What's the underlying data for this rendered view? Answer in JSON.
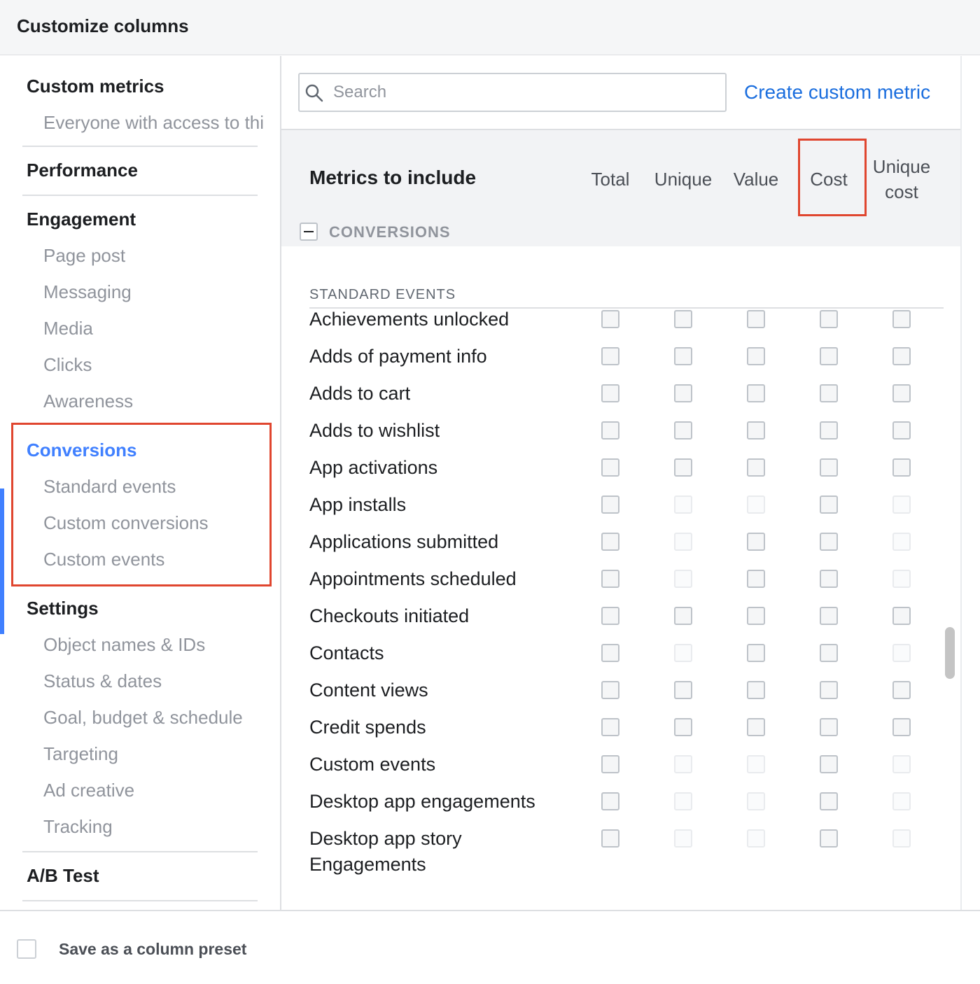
{
  "dialog": {
    "title": "Customize columns"
  },
  "sidebar": {
    "sections": [
      {
        "title": "Custom metrics",
        "items": [
          "Everyone with access to thi"
        ]
      },
      {
        "title": "Performance",
        "items": []
      },
      {
        "title": "Engagement",
        "items": [
          "Page post",
          "Messaging",
          "Media",
          "Clicks",
          "Awareness"
        ]
      },
      {
        "title": "Conversions",
        "active": true,
        "items": [
          "Standard events",
          "Custom conversions",
          "Custom events"
        ]
      },
      {
        "title": "Settings",
        "items": [
          "Object names & IDs",
          "Status & dates",
          "Goal, budget & schedule",
          "Targeting",
          "Ad creative",
          "Tracking"
        ]
      },
      {
        "title": "A/B Test",
        "items": []
      }
    ]
  },
  "search": {
    "placeholder": "Search",
    "value": ""
  },
  "create_link": "Create custom metric",
  "metrics": {
    "title": "Metrics to include",
    "columns": [
      "Total",
      "Unique",
      "Value",
      "Cost",
      "Unique\ncost"
    ],
    "group_label": "CONVERSIONS",
    "subgroup_label": "STANDARD EVENTS",
    "rows": [
      {
        "label": "Achievements unlocked",
        "enabled": [
          true,
          true,
          true,
          true,
          true
        ]
      },
      {
        "label": "Adds of payment info",
        "enabled": [
          true,
          true,
          true,
          true,
          true
        ]
      },
      {
        "label": "Adds to cart",
        "enabled": [
          true,
          true,
          true,
          true,
          true
        ]
      },
      {
        "label": "Adds to wishlist",
        "enabled": [
          true,
          true,
          true,
          true,
          true
        ]
      },
      {
        "label": "App activations",
        "enabled": [
          true,
          true,
          true,
          true,
          true
        ]
      },
      {
        "label": "App installs",
        "enabled": [
          true,
          false,
          false,
          true,
          false
        ]
      },
      {
        "label": "Applications submitted",
        "enabled": [
          true,
          false,
          true,
          true,
          false
        ]
      },
      {
        "label": "Appointments scheduled",
        "enabled": [
          true,
          false,
          true,
          true,
          false
        ]
      },
      {
        "label": "Checkouts initiated",
        "enabled": [
          true,
          true,
          true,
          true,
          true
        ]
      },
      {
        "label": "Contacts",
        "enabled": [
          true,
          false,
          true,
          true,
          false
        ]
      },
      {
        "label": "Content views",
        "enabled": [
          true,
          true,
          true,
          true,
          true
        ]
      },
      {
        "label": "Credit spends",
        "enabled": [
          true,
          true,
          true,
          true,
          true
        ]
      },
      {
        "label": "Custom events",
        "enabled": [
          true,
          false,
          false,
          true,
          false
        ]
      },
      {
        "label": "Desktop app engagements",
        "enabled": [
          true,
          false,
          false,
          true,
          false
        ]
      },
      {
        "label": "Desktop app story Engagements",
        "enabled": [
          true,
          false,
          false,
          true,
          false
        ]
      }
    ]
  },
  "footer": {
    "preset_label": "Save as a column preset"
  },
  "colors": {
    "accent": "#1b6ede",
    "active_bar": "#4080ff",
    "highlight": "#e0462f"
  }
}
